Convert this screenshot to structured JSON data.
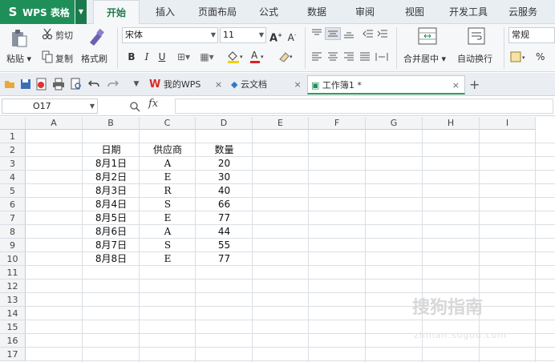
{
  "app": {
    "logo": "S",
    "title": "WPS 表格"
  },
  "menu": {
    "tabs": [
      "开始",
      "插入",
      "页面布局",
      "公式",
      "数据",
      "审阅",
      "视图",
      "开发工具",
      "云服务"
    ]
  },
  "ribbon": {
    "paste": "粘贴",
    "cut": "剪切",
    "copy": "复制",
    "format_painter": "格式刷",
    "font_name": "宋体",
    "font_size": "11",
    "merge_center": "合并居中",
    "wrap_text": "自动换行",
    "number_format": "常规",
    "percent": "%"
  },
  "doc_tabs": {
    "tab1": "我的WPS",
    "tab2": "云文档",
    "tab3": "工作簿1 *",
    "new_tab": "+"
  },
  "formula_bar": {
    "name_box": "O17",
    "fx": "fx",
    "value": ""
  },
  "columns": [
    "A",
    "B",
    "C",
    "D",
    "E",
    "F",
    "G",
    "H",
    "I"
  ],
  "rows": [
    "1",
    "2",
    "3",
    "4",
    "5",
    "6",
    "7",
    "8",
    "9",
    "10",
    "11",
    "12",
    "13",
    "14",
    "15",
    "16",
    "17"
  ],
  "sheet": {
    "headers": [
      "日期",
      "供应商",
      "数量"
    ],
    "data": [
      [
        "8月1日",
        "A",
        "20"
      ],
      [
        "8月2日",
        "E",
        "30"
      ],
      [
        "8月3日",
        "R",
        "40"
      ],
      [
        "8月4日",
        "S",
        "66"
      ],
      [
        "8月5日",
        "E",
        "77"
      ],
      [
        "8月6日",
        "A",
        "44"
      ],
      [
        "8月7日",
        "S",
        "55"
      ],
      [
        "8月8日",
        "E",
        "77"
      ]
    ]
  },
  "watermark": {
    "text": "搜狗指南",
    "url": "zhinan.sogou.com"
  },
  "colors": {
    "accent": "#1f8f5a",
    "grid_line": "#dadfe4",
    "header_bg": "#f2f4f6"
  }
}
